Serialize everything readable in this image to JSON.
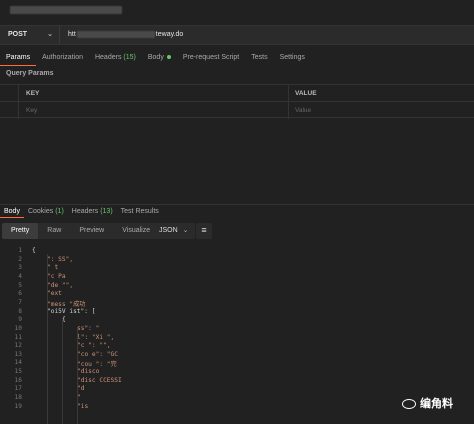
{
  "request": {
    "method": "POST",
    "url_prefix": "htt",
    "url_suffix": "teway.do"
  },
  "request_tabs": [
    {
      "label": "Params",
      "count": ""
    },
    {
      "label": "Authorization",
      "count": ""
    },
    {
      "label": "Headers",
      "count": "(15)"
    },
    {
      "label": "Body",
      "count": ""
    },
    {
      "label": "Pre-request Script",
      "count": ""
    },
    {
      "label": "Tests",
      "count": ""
    },
    {
      "label": "Settings",
      "count": ""
    }
  ],
  "query_params": {
    "title": "Query Params",
    "header_key": "KEY",
    "header_value": "VALUE",
    "placeholder_key": "Key",
    "placeholder_value": "Value"
  },
  "response_tabs": [
    {
      "label": "Body",
      "count": ""
    },
    {
      "label": "Cookies",
      "count": "(1)"
    },
    {
      "label": "Headers",
      "count": "(13)"
    },
    {
      "label": "Test Results",
      "count": ""
    }
  ],
  "view_modes": [
    "Pretty",
    "Raw",
    "Preview",
    "Visualize"
  ],
  "format": "JSON",
  "code_lines": [
    {
      "n": "1",
      "t": "{"
    },
    {
      "n": "2",
      "t": "\":  SS\","
    },
    {
      "n": "3",
      "t": "\"  t"
    },
    {
      "n": "4",
      "t": "\"c  Pa"
    },
    {
      "n": "5",
      "t": "\"de  \"\","
    },
    {
      "n": "6",
      "t": "\"ext"
    },
    {
      "n": "7",
      "t": "\"mess  \"成功"
    },
    {
      "n": "8",
      "t": "\"oi5V  ist\": ["
    },
    {
      "n": "9",
      "t": "{"
    },
    {
      "n": "10",
      "t": "ss\": \""
    },
    {
      "n": "11",
      "t": "l\": \"Xi  \","
    },
    {
      "n": "12",
      "t": "\"c  \":  \"\","
    },
    {
      "n": "13",
      "t": "\"co  e\": \"GC"
    },
    {
      "n": "14",
      "t": "\"cou  \": \"完"
    },
    {
      "n": "15",
      "t": "\"disco"
    },
    {
      "n": "16",
      "t": "\"disc  CCESSI"
    },
    {
      "n": "17",
      "t": "\"d"
    },
    {
      "n": "18",
      "t": "\""
    },
    {
      "n": "19",
      "t": "\"is"
    }
  ],
  "watermark": "编角料",
  "icons": {
    "dropdown": "chevron-down-icon",
    "wrap": "wrap-lines-icon",
    "logo": "watermark-logo-icon"
  },
  "colors": {
    "accent": "#ff6c37",
    "green": "#6bc56b",
    "background": "#212121"
  }
}
